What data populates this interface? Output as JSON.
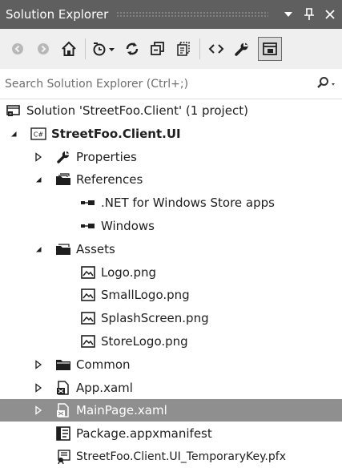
{
  "window": {
    "title": "Solution Explorer"
  },
  "title_buttons": {
    "dropdown_glyph": "▾",
    "pin_glyph": "ᵖ",
    "close_glyph": "✕"
  },
  "toolbar": {
    "icons": [
      "back-icon",
      "forward-icon",
      "home-icon",
      "pending-changes-icon",
      "sync-icon",
      "collapse-all-icon",
      "show-all-files-icon",
      "view-code-icon",
      "properties-icon",
      "preview-icon"
    ]
  },
  "search": {
    "placeholder": "Search Solution Explorer (Ctrl+;)",
    "value": ""
  },
  "tree": {
    "items": [
      {
        "label": "Solution 'StreetFoo.Client' (1 project)",
        "icon": "solution-icon",
        "level": 0,
        "expander": "none",
        "bold": false,
        "selected": false
      },
      {
        "label": "StreetFoo.Client.UI",
        "icon": "csharp-project-icon",
        "level": 1,
        "expander": "expanded",
        "bold": true,
        "selected": false
      },
      {
        "label": "Properties",
        "icon": "wrench-icon",
        "level": 2,
        "expander": "collapsed",
        "bold": false,
        "selected": false
      },
      {
        "label": "References",
        "icon": "references-folder-icon",
        "level": 2,
        "expander": "expanded",
        "bold": false,
        "selected": false
      },
      {
        "label": ".NET for Windows Store apps",
        "icon": "reference-icon",
        "level": 3,
        "expander": "none",
        "bold": false,
        "selected": false
      },
      {
        "label": "Windows",
        "icon": "reference-icon",
        "level": 3,
        "expander": "none",
        "bold": false,
        "selected": false
      },
      {
        "label": "Assets",
        "icon": "folder-open-icon",
        "level": 2,
        "expander": "expanded",
        "bold": false,
        "selected": false
      },
      {
        "label": "Logo.png",
        "icon": "image-file-icon",
        "level": 3,
        "expander": "none",
        "bold": false,
        "selected": false
      },
      {
        "label": "SmallLogo.png",
        "icon": "image-file-icon",
        "level": 3,
        "expander": "none",
        "bold": false,
        "selected": false
      },
      {
        "label": "SplashScreen.png",
        "icon": "image-file-icon",
        "level": 3,
        "expander": "none",
        "bold": false,
        "selected": false
      },
      {
        "label": "StoreLogo.png",
        "icon": "image-file-icon",
        "level": 3,
        "expander": "none",
        "bold": false,
        "selected": false
      },
      {
        "label": "Common",
        "icon": "folder-icon",
        "level": 2,
        "expander": "collapsed",
        "bold": false,
        "selected": false
      },
      {
        "label": "App.xaml",
        "icon": "xaml-file-icon",
        "level": 2,
        "expander": "collapsed",
        "bold": false,
        "selected": false
      },
      {
        "label": "MainPage.xaml",
        "icon": "xaml-file-icon",
        "level": 2,
        "expander": "collapsed",
        "bold": false,
        "selected": true
      },
      {
        "label": "Package.appxmanifest",
        "icon": "manifest-file-icon",
        "level": 2,
        "expander": "none",
        "bold": false,
        "selected": false
      },
      {
        "label": "StreetFoo.Client.UI_TemporaryKey.pfx",
        "icon": "certificate-file-icon",
        "level": 2,
        "expander": "none",
        "bold": false,
        "selected": false
      }
    ]
  },
  "colors": {
    "titlebar_bg": "#5f5f5f",
    "toolbar_bg": "#efefef",
    "selection_bg": "#8f8f8f",
    "text": "#1e1e1e"
  }
}
